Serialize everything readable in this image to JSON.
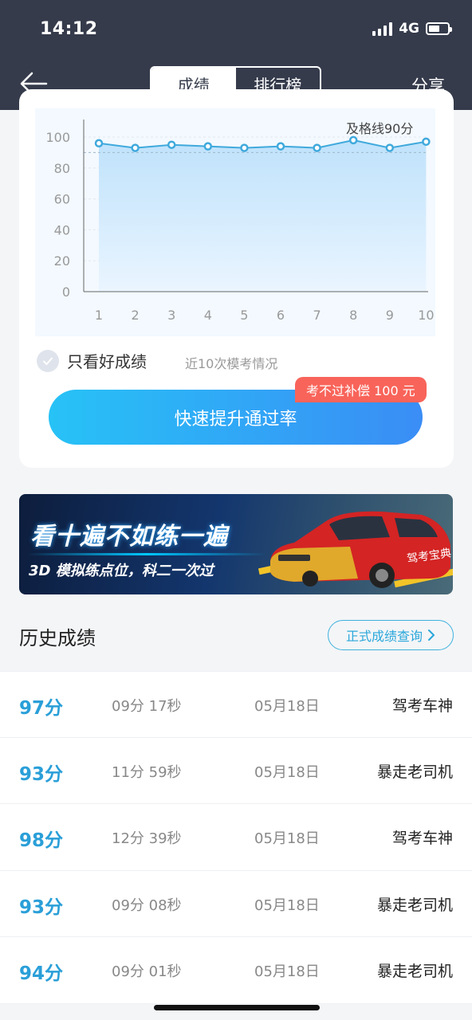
{
  "status": {
    "time": "14:12",
    "network": "4G"
  },
  "nav": {
    "tabs": [
      "成绩",
      "排行榜"
    ],
    "active_tab": "成绩",
    "share": "分享"
  },
  "chart": {
    "pass_line_label": "及格线90分",
    "check_label": "只看好成绩",
    "subtitle": "近10次模考情况"
  },
  "chart_data": {
    "type": "area",
    "x": [
      1,
      2,
      3,
      4,
      5,
      6,
      7,
      8,
      9,
      10
    ],
    "values": [
      96,
      93,
      95,
      94,
      93,
      94,
      93,
      98,
      93,
      97
    ],
    "yticks": [
      0,
      20,
      40,
      60,
      80,
      100
    ],
    "ylim": [
      0,
      100
    ],
    "reference_line": 90,
    "colors": {
      "line": "#3fa9dc",
      "fill_top": "#bfe2fb",
      "fill_bottom": "#eaf5ff"
    }
  },
  "cta": {
    "label": "快速提升通过率",
    "promo": "考不过补偿 100 元"
  },
  "banner": {
    "headline": "看十遍不如练一遍",
    "sub": "3D 模拟练点位，科二一次过",
    "car_text": "驾考宝典"
  },
  "history": {
    "title": "历史成绩",
    "query_button": "正式成绩查询",
    "rows": [
      {
        "score": "97分",
        "duration": "09分 17秒",
        "date": "05月18日",
        "title": "驾考车神"
      },
      {
        "score": "93分",
        "duration": "11分 59秒",
        "date": "05月18日",
        "title": "暴走老司机"
      },
      {
        "score": "98分",
        "duration": "12分 39秒",
        "date": "05月18日",
        "title": "驾考车神"
      },
      {
        "score": "93分",
        "duration": "09分 08秒",
        "date": "05月18日",
        "title": "暴走老司机"
      },
      {
        "score": "94分",
        "duration": "09分 01秒",
        "date": "05月18日",
        "title": "暴走老司机"
      }
    ]
  }
}
